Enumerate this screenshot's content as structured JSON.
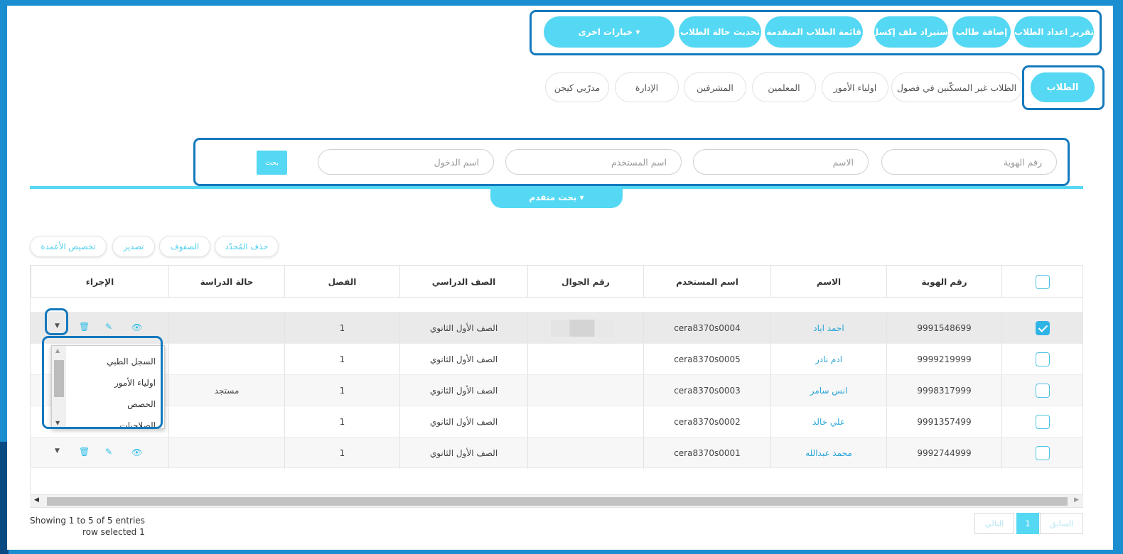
{
  "toolbar": {
    "buttons": [
      {
        "label": "تقرير اعداد الطلاب"
      },
      {
        "label": "إضافة طالب"
      },
      {
        "label": "استيراد ملف إكسل"
      },
      {
        "label": "قائمة الطلاب المتقدمة"
      },
      {
        "label": "تحديث حالة الطلاب"
      },
      {
        "label": "خيارات اخرى ▾"
      }
    ]
  },
  "tabs": [
    {
      "label": "الطلاب",
      "active": true
    },
    {
      "label": "الطلاب غير المسكّنين في فصول"
    },
    {
      "label": "اولياء الأمور"
    },
    {
      "label": "المعلمين"
    },
    {
      "label": "المشرفين"
    },
    {
      "label": "الإدارة"
    },
    {
      "label": "مدرّبي كيجن"
    }
  ],
  "search": {
    "id_placeholder": "رقم الهوية",
    "name_placeholder": "الاسم",
    "username_placeholder": "اسم المستخدم",
    "login_placeholder": "اسم الدخول",
    "search_button": "بحث",
    "advanced_label": "بحث متقدم ▾"
  },
  "table_tools": {
    "delete_selected": "حذف المُحدّد",
    "rows": "الصفوف",
    "export": "تصدير",
    "customize_columns": "تخصيص الأعمدة"
  },
  "table": {
    "columns": [
      "رقم الهوية",
      "الاسم",
      "اسم المستخدم",
      "رقم الجوال",
      "الصف الدراسي",
      "الفصل",
      "حالة الدراسة",
      "الإجراء"
    ],
    "rows": [
      {
        "id": "9991548699",
        "name": "احمد اياد",
        "username": "cera8370s0004",
        "mobile": "",
        "grade": "الصف الأول الثانوي",
        "class": "1",
        "status": "",
        "checked": true
      },
      {
        "id": "9999219999",
        "name": "ادم نادر",
        "username": "cera8370s0005",
        "mobile": "",
        "grade": "الصف الأول الثانوي",
        "class": "1",
        "status": "",
        "checked": false
      },
      {
        "id": "9998317999",
        "name": "انس سامر",
        "username": "cera8370s0003",
        "mobile": "",
        "grade": "الصف الأول الثانوي",
        "class": "1",
        "status": "مستجد",
        "checked": false
      },
      {
        "id": "9991357499",
        "name": "علي خالد",
        "username": "cera8370s0002",
        "mobile": "",
        "grade": "الصف الأول الثانوي",
        "class": "1",
        "status": "",
        "checked": false
      },
      {
        "id": "9992744999",
        "name": "محمد عبدالله",
        "username": "cera8370s0001",
        "mobile": "",
        "grade": "الصف الأول الثانوي",
        "class": "1",
        "status": "",
        "checked": false
      }
    ]
  },
  "action_menu": {
    "items": [
      "السجل الطبي",
      "اولياء الأمور",
      "الحصص",
      "الصلاحيات"
    ]
  },
  "footer": {
    "showing": "Showing 1 to 5 of 5 entries",
    "selected": "row selected 1",
    "prev": "السابق",
    "page": "1",
    "next": "التالي"
  },
  "colors": {
    "accent": "#55d8f3",
    "highlight": "#1479bd",
    "frame": "#1b8ed0"
  }
}
